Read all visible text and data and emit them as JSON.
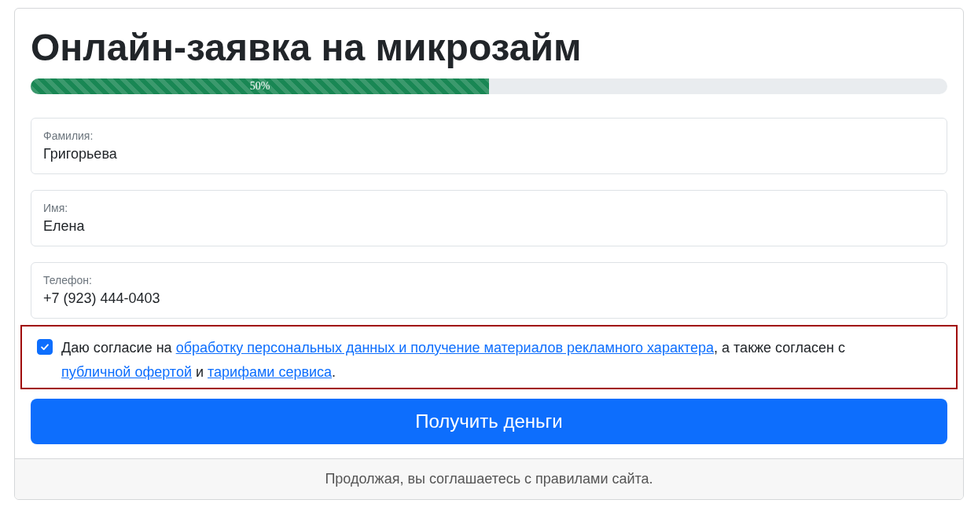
{
  "title": "Онлайн-заявка на микрозайм",
  "progress": {
    "level": 0.5,
    "label": "50%"
  },
  "fields": [
    {
      "label": "Фамилия:",
      "value": "Григорьева"
    },
    {
      "label": "Имя:",
      "value": "Елена"
    },
    {
      "label": "Телефон:",
      "value": "+7 (923) 444-0403"
    }
  ],
  "consent": {
    "checked": true,
    "parts": [
      {
        "kind": "text",
        "text": "Даю согласие на "
      },
      {
        "kind": "link",
        "text": "обработку персональных данных и получение материалов рекламного характера"
      },
      {
        "kind": "text",
        "text": ", а также согласен с "
      },
      {
        "kind": "link",
        "text": "публичной офертой"
      },
      {
        "kind": "text",
        "text": " и "
      },
      {
        "kind": "link",
        "text": "тарифами сервиса"
      },
      {
        "kind": "text",
        "text": "."
      }
    ]
  },
  "submit": "Получить деньги",
  "footer": "Продолжая, вы соглашаетесь с правилами сайта."
}
